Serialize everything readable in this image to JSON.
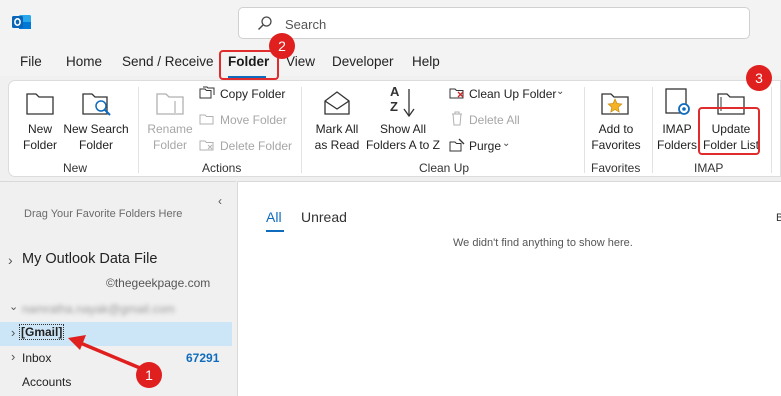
{
  "search": {
    "placeholder": "Search"
  },
  "menu": {
    "file": "File",
    "home": "Home",
    "send_receive": "Send / Receive",
    "folder": "Folder",
    "view": "View",
    "developer": "Developer",
    "help": "Help"
  },
  "ribbon": {
    "new_folder": [
      "New",
      "Folder"
    ],
    "new_search_folder": [
      "New Search",
      "Folder"
    ],
    "rename_folder": [
      "Rename",
      "Folder"
    ],
    "copy_folder": "Copy Folder",
    "move_folder": "Move Folder",
    "delete_folder": "Delete Folder",
    "mark_all_as_read": [
      "Mark All",
      "as Read"
    ],
    "show_all_folders": [
      "Show All",
      "Folders A to Z"
    ],
    "clean_up_folder": "Clean Up Folder",
    "delete_all": "Delete All",
    "purge": "Purge",
    "add_to_favorites": [
      "Add to",
      "Favorites"
    ],
    "imap_folders": [
      "IMAP",
      "Folders"
    ],
    "update_folder_list": [
      "Update",
      "Folder List"
    ],
    "sort_glyph": [
      "A",
      "Z"
    ],
    "groups": {
      "new": "New",
      "actions": "Actions",
      "clean_up": "Clean Up",
      "favorites": "Favorites",
      "imap": "IMAP"
    }
  },
  "left_pane": {
    "fav_hint": "Drag Your Favorite Folders Here",
    "data_file": "My Outlook Data File",
    "watermark": "©thegeekpage.com",
    "account_email": "namratha.nayak@gmail.com",
    "gmail": "[Gmail]",
    "inbox": "Inbox",
    "inbox_count": "67291",
    "accounts": "Accounts"
  },
  "main": {
    "tab_all": "All",
    "tab_unread": "Unread",
    "empty_message": "We didn't find anything to show here.",
    "edge_letter": "B"
  },
  "annotations": {
    "badge_1": "1",
    "badge_2": "2",
    "badge_3": "3"
  },
  "colors": {
    "accent": "#0f6cbd",
    "highlight_red": "#e02c2c",
    "selection": "#cde6f7"
  }
}
